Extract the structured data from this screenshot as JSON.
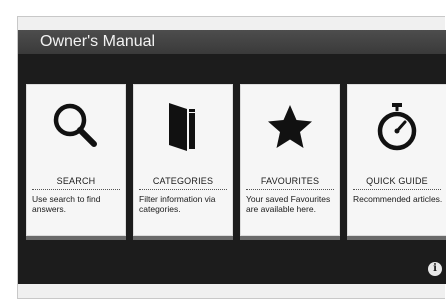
{
  "header": {
    "title": "Owner's Manual"
  },
  "cards": [
    {
      "label": "SEARCH",
      "description": "Use search to find answers.",
      "icon": "search-icon"
    },
    {
      "label": "CATEGORIES",
      "description": "Filter information via categories.",
      "icon": "book-icon"
    },
    {
      "label": "FAVOURITES",
      "description": "Your saved Favourites are available here.",
      "icon": "star-icon"
    },
    {
      "label": "QUICK GUIDE",
      "description": "Recommended articles.",
      "icon": "stopwatch-icon"
    }
  ],
  "footer": {
    "info_icon": "info-icon",
    "info_glyph": "i"
  },
  "colors": {
    "screen": "#1c1c1c",
    "title_bar": "#444444",
    "card": "#f6f6f6",
    "text": "#1a1a1a"
  }
}
